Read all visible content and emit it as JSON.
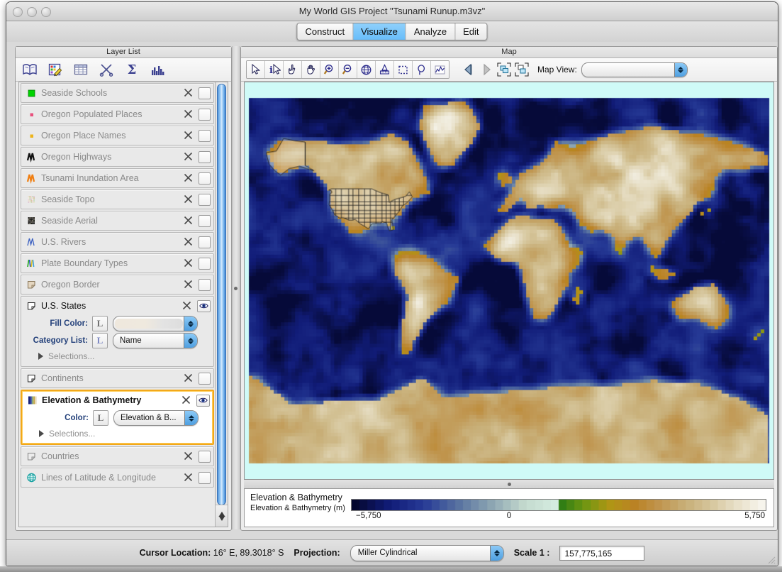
{
  "window": {
    "title": "My World GIS Project \"Tsunami Runup.m3vz\"",
    "traffic_lights": [
      "close-button",
      "minimize-button",
      "zoom-button"
    ]
  },
  "tabs": [
    {
      "label": "Construct",
      "active": false
    },
    {
      "label": "Visualize",
      "active": true
    },
    {
      "label": "Analyze",
      "active": false
    },
    {
      "label": "Edit",
      "active": false
    }
  ],
  "layer_panel": {
    "title": "Layer List",
    "toolbar": [
      {
        "name": "library-icon",
        "tip": "Library"
      },
      {
        "name": "edit-legend-icon",
        "tip": "Edit Legend"
      },
      {
        "name": "table-icon",
        "tip": "Show Table"
      },
      {
        "name": "scissors-icon",
        "tip": "Cut"
      },
      {
        "name": "sigma-icon",
        "tip": "Summarize"
      },
      {
        "name": "histogram-icon",
        "tip": "Histogram"
      }
    ],
    "layers": [
      {
        "name": "Seaside Schools",
        "icon": "green-square-point-icon",
        "visible": false,
        "selected": false,
        "expanded": false
      },
      {
        "name": "Oregon Populated Places",
        "icon": "pink-dot-point-icon",
        "visible": false,
        "selected": false,
        "expanded": false
      },
      {
        "name": "Oregon Place Names",
        "icon": "yellow-dot-point-icon",
        "visible": false,
        "selected": false,
        "expanded": false
      },
      {
        "name": "Oregon Highways",
        "icon": "black-line-icon",
        "visible": false,
        "selected": false,
        "expanded": false
      },
      {
        "name": "Tsunami Inundation Area",
        "icon": "orange-line-icon",
        "visible": false,
        "selected": false,
        "expanded": false
      },
      {
        "name": "Seaside Topo",
        "icon": "raster-topo-icon",
        "visible": false,
        "selected": false,
        "expanded": false
      },
      {
        "name": "Seaside Aerial",
        "icon": "raster-aerial-icon",
        "visible": false,
        "selected": false,
        "expanded": false
      },
      {
        "name": "U.S. Rivers",
        "icon": "blue-line-icon",
        "visible": false,
        "selected": false,
        "expanded": false
      },
      {
        "name": "Plate Boundary Types",
        "icon": "multicolor-line-icon",
        "visible": false,
        "selected": false,
        "expanded": false
      },
      {
        "name": "Oregon Border",
        "icon": "tan-polygon-icon",
        "visible": false,
        "selected": false,
        "expanded": false
      },
      {
        "name": "U.S. States",
        "icon": "white-polygon-icon",
        "visible": true,
        "selected": false,
        "expanded": true,
        "properties": [
          {
            "label": "Fill Color:",
            "legend_button": "L",
            "value": "",
            "is_swatch": true
          },
          {
            "label": "Category List:",
            "legend_button": "L",
            "value": "Name",
            "is_swatch": false
          }
        ],
        "selections_label": "Selections..."
      },
      {
        "name": "Continents",
        "icon": "white-polygon-icon",
        "visible": false,
        "selected": false,
        "expanded": false
      },
      {
        "name": "Elevation & Bathymetry",
        "icon": "raster-elevation-icon",
        "visible": true,
        "selected": true,
        "expanded": true,
        "properties": [
          {
            "label": "Color:",
            "legend_button": "L",
            "value": "Elevation & B...",
            "is_swatch": false
          }
        ],
        "selections_label": "Selections..."
      },
      {
        "name": "Countries",
        "icon": "gray-polygon-icon",
        "visible": false,
        "selected": false,
        "expanded": false
      },
      {
        "name": "Lines of Latitude & Longitude",
        "icon": "globe-grid-icon",
        "visible": false,
        "selected": false,
        "expanded": false
      }
    ]
  },
  "map_panel": {
    "title": "Map",
    "tools": [
      {
        "name": "select-arrow-tool",
        "label": "Select"
      },
      {
        "name": "info-tool",
        "label": "Identify"
      },
      {
        "name": "pointing-hand-tool",
        "label": "Click"
      },
      {
        "name": "pan-hand-tool",
        "label": "Pan"
      },
      {
        "name": "zoom-in-tool",
        "label": "Zoom In"
      },
      {
        "name": "zoom-out-tool",
        "label": "Zoom Out"
      },
      {
        "name": "globe-tool",
        "label": "Globe"
      },
      {
        "name": "measure-tool",
        "label": "Measure"
      },
      {
        "name": "box-select-tool",
        "label": "Box Select"
      },
      {
        "name": "lasso-select-tool",
        "label": "Lasso Select"
      },
      {
        "name": "profile-tool",
        "label": "Profile"
      }
    ],
    "nav": [
      {
        "name": "back-button",
        "enabled": true
      },
      {
        "name": "forward-button",
        "enabled": false
      },
      {
        "name": "zoom-to-all-button",
        "enabled": true
      },
      {
        "name": "zoom-to-selection-button",
        "enabled": true
      }
    ],
    "map_view": {
      "label": "Map View:",
      "value": "",
      "placeholder": ""
    }
  },
  "legend": {
    "title": "Elevation & Bathymetry",
    "subtitle": "Elevation & Bathymetry (m)",
    "min_label": "−5,750",
    "mid_label": "0",
    "max_label": "5,750"
  },
  "status_bar": {
    "cursor_label": "Cursor Location:",
    "cursor_value": "16° E, 89.3018° S",
    "projection_label": "Projection:",
    "projection_value": "Miller Cylindrical",
    "scale_label": "Scale 1 :",
    "scale_value": "157,775,165"
  },
  "colors": {
    "tab_active": "#68bdfa",
    "selection_highlight": "#f2a81a",
    "scrollbar": "#4f94dd",
    "ocean_deep": "#0b1f6b",
    "land_green": "#2f7a14",
    "land_tan": "#d9c39a"
  },
  "chart_data": {
    "type": "heatmap",
    "title": "Elevation & Bathymetry",
    "ylabel": "Elevation & Bathymetry (m)",
    "colorbar_range": [
      -5750,
      5750
    ],
    "colorbar_ticks": [
      -5750,
      0,
      5750
    ],
    "projection": "Miller Cylindrical",
    "scale": "1:157,775,165"
  }
}
